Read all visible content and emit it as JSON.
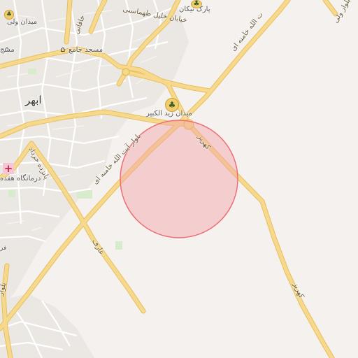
{
  "map": {
    "colors": {
      "background": "#f4f1ee",
      "road_major": "#f6d98c",
      "road_casing": "#e8bf5c",
      "street": "#ffffff",
      "block": "#ebe7e3",
      "park": "#d7ebcd",
      "marker_fill": "#f5a4a8",
      "marker_stroke": "#ef6f78"
    },
    "labels": {
      "city": "ابهر",
      "square_zeid": "میدان زید الکبیر",
      "park_negikan": "پارک نیکان",
      "khalil_street": "خیابان خلیل طهماسبی",
      "square_vali": "میدان ولی",
      "mosque_jame": "مسجد جامع",
      "mosque_partial": "مسج",
      "clinic": "درمانگاه هفده",
      "panzdah_khordad": "پانزده خرداد",
      "khaqani": "خاقانی",
      "aref": "عارف",
      "kahriz_1": "کهریز",
      "kahriz_2": "کهریز",
      "blvd_main": "بلوار آیت الله خامنه ای",
      "blvd_upper": "ت الله خامنه ای",
      "blvd_right": "بلوار ولی",
      "edge_bottom_left": "بلوار",
      "edge_left_fa": "فر"
    },
    "icons": {
      "square_zeid": "tree-icon",
      "park_negikan": "tree-icon",
      "square_vali": "tree-icon",
      "mosque_jame": "mosque-icon",
      "mosque_partial": "mosque-icon",
      "clinic": "hospital-icon"
    }
  }
}
